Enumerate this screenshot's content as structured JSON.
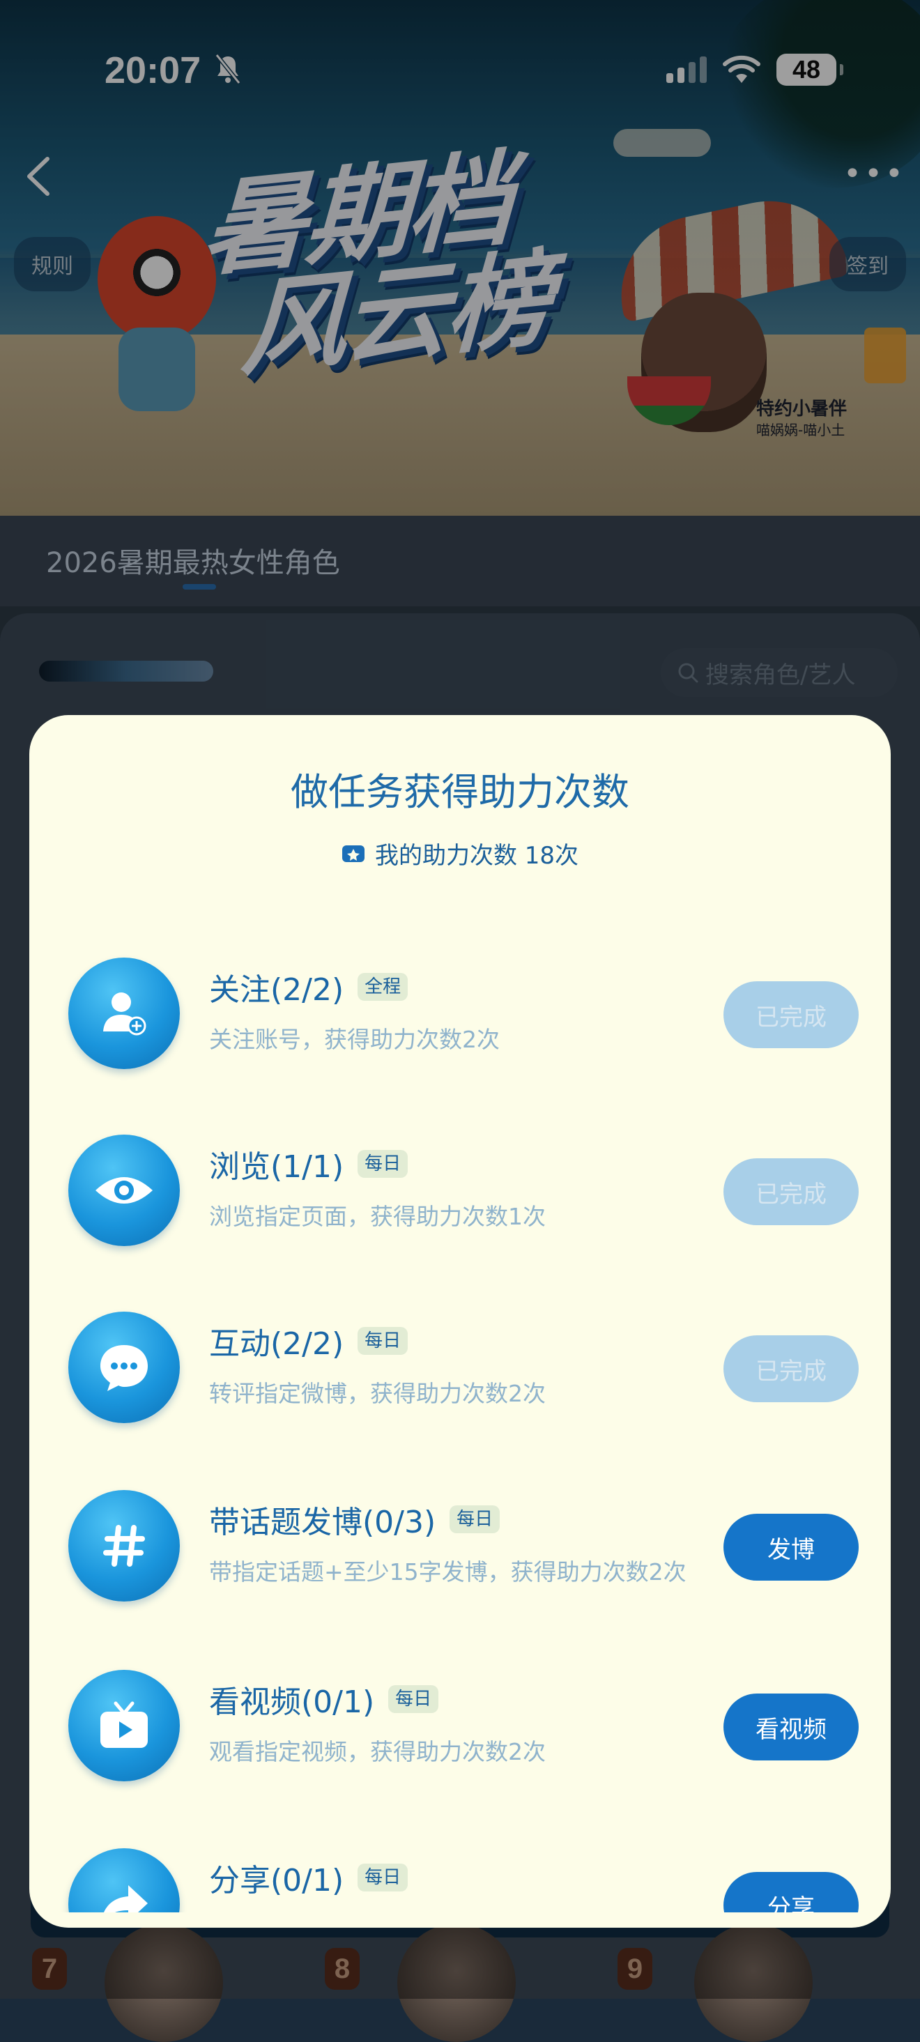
{
  "status_bar": {
    "time": "20:07",
    "battery": "48"
  },
  "header": {
    "rules_label": "规则",
    "checkin_label": "签到",
    "more_label": "•••"
  },
  "hero": {
    "title_line1": "暑期档",
    "title_line2": "风云榜",
    "badge_title": "特约小暑伴",
    "badge_sub": "喵娲娲-喵小土"
  },
  "ranking": {
    "tab_label": "2026暑期最热女性角色",
    "search_placeholder": "搜索角色/艺人",
    "rank_numbers": [
      "7",
      "8",
      "9"
    ]
  },
  "modal": {
    "title": "做任务获得助力次数",
    "assist_label": "我的助力次数 18次",
    "tasks": [
      {
        "name": "关注(2/2)",
        "tag": "全程",
        "desc": "关注账号，获得助力次数2次",
        "button": "已完成",
        "icon": "follow-user-icon",
        "done": true
      },
      {
        "name": "浏览(1/1)",
        "tag": "每日",
        "desc": "浏览指定页面，获得助力次数1次",
        "button": "已完成",
        "icon": "eye-icon",
        "done": true
      },
      {
        "name": "互动(2/2)",
        "tag": "每日",
        "desc": "转评指定微博，获得助力次数2次",
        "button": "已完成",
        "icon": "chat-bubble-icon",
        "done": true
      },
      {
        "name": "带话题发博(0/3)",
        "tag": "每日",
        "desc": "带指定话题+至少15字发博，获得助力次数2次",
        "button": "发博",
        "icon": "hashtag-icon",
        "done": false
      },
      {
        "name": "看视频(0/1)",
        "tag": "每日",
        "desc": "观看指定视频，获得助力次数2次",
        "button": "看视频",
        "icon": "tv-play-icon",
        "done": false
      },
      {
        "name": "分享(0/1)",
        "tag": "每日",
        "desc": "",
        "button": "分享",
        "icon": "share-arrow-icon",
        "done": false
      }
    ]
  },
  "colors": {
    "accent": "#1575c9",
    "done_button": "#a8cfe8",
    "modal_bg": "#fdfde8",
    "title": "#1e6aa8"
  }
}
